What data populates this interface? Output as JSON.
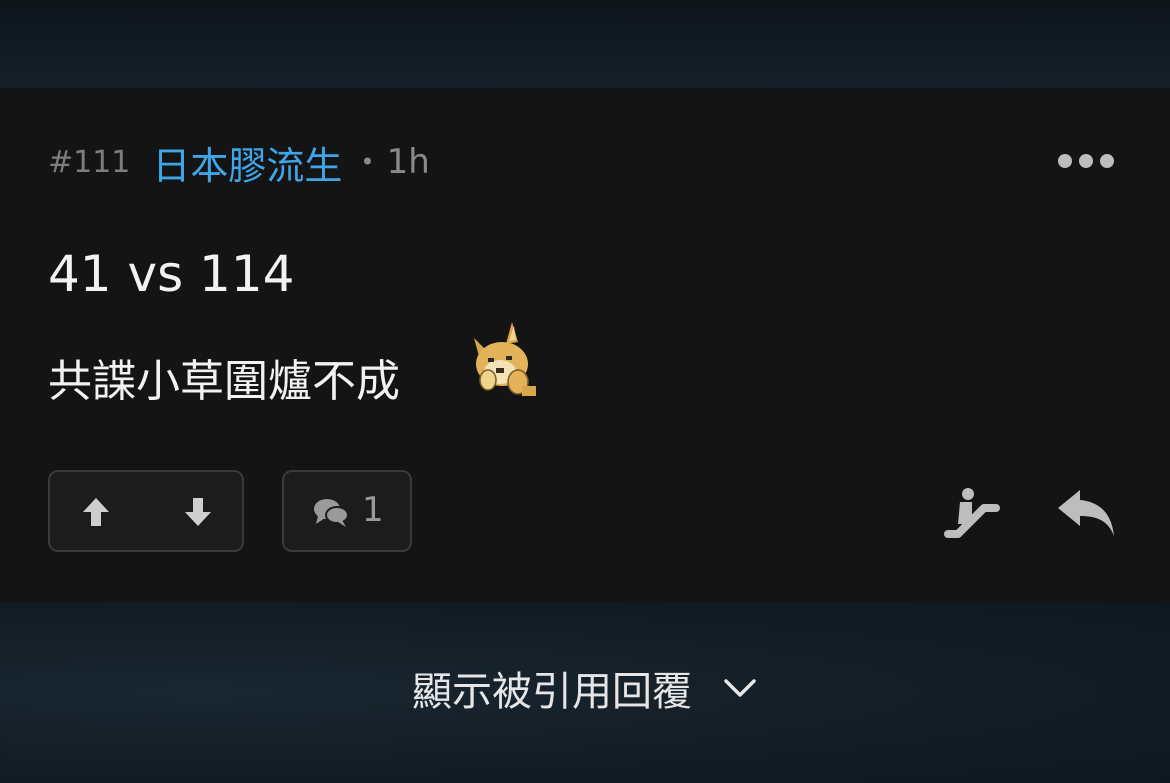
{
  "post": {
    "floor": "#111",
    "author": "日本膠流生",
    "separator": "•",
    "time_ago": "1h",
    "content_line1": "41 vs 114",
    "content_line2": "共諜小草圍爐不成",
    "comment_count": "1"
  },
  "footer": {
    "show_quoted_label": "顯示被引用回覆"
  },
  "colors": {
    "author": "#3ea6e8",
    "card_bg": "#141414",
    "page_bg": "#101820"
  },
  "icons": [
    "more-icon",
    "sticker-icon",
    "upvote-icon",
    "downvote-icon",
    "comment-icon",
    "escalator-icon",
    "reply-icon",
    "chevron-down-icon"
  ]
}
